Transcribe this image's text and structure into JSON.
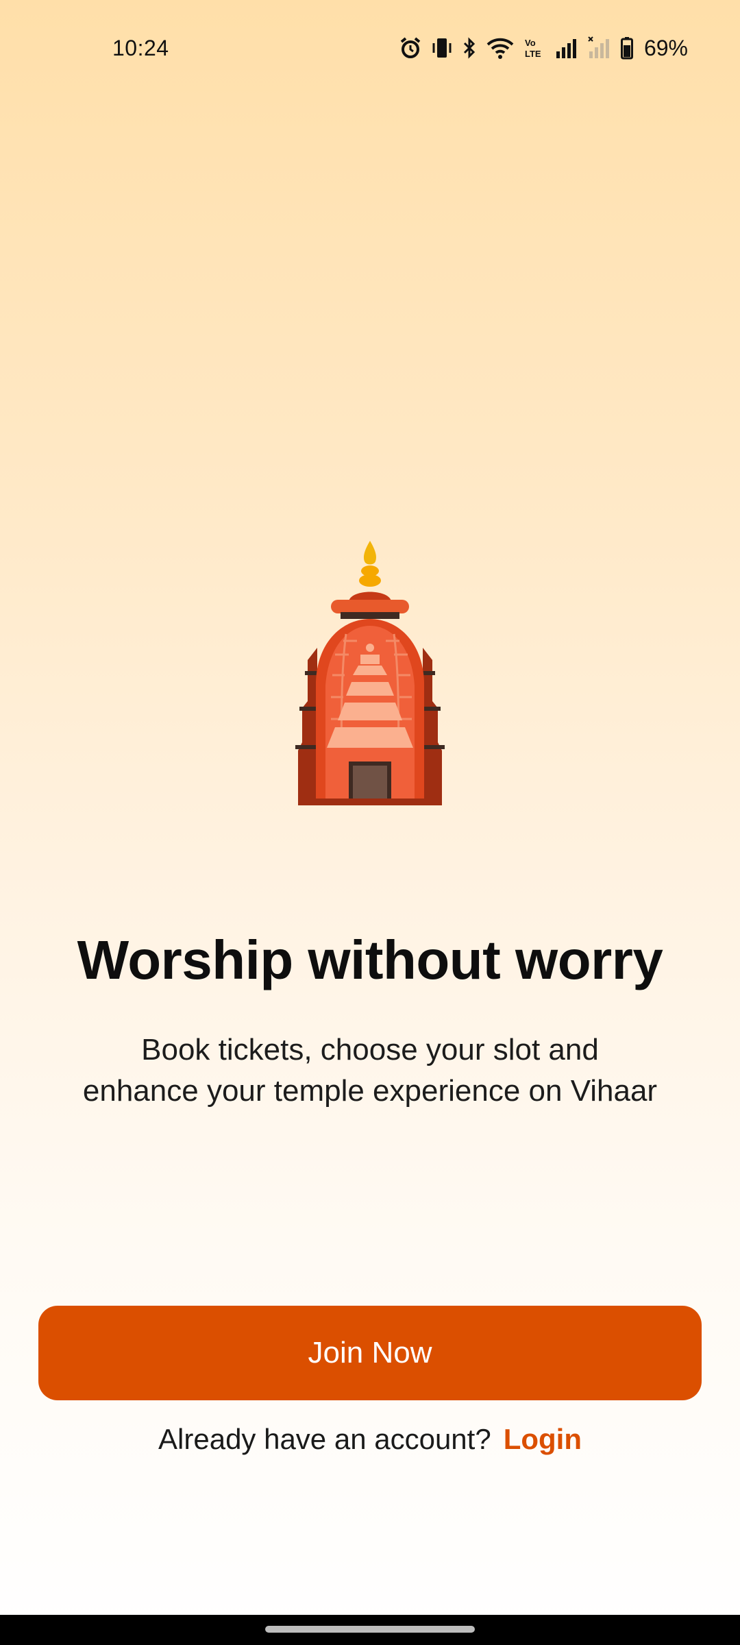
{
  "status_bar": {
    "time": "10:24",
    "icons": [
      "alarm-icon",
      "vibrate-icon",
      "bluetooth-icon",
      "wifi-icon",
      "volte-icon",
      "signal-icon",
      "signal-no-service-icon",
      "battery-icon"
    ],
    "volte_label": "Vo LTE",
    "battery_percent": "69%"
  },
  "hero": {
    "icon": "temple-icon"
  },
  "onboarding": {
    "headline": "Worship without worry",
    "subtitle_line1": "Book tickets, choose your slot and",
    "subtitle_line2": "enhance your temple experience on Vihaar"
  },
  "actions": {
    "join_label": "Join Now",
    "login_prompt": "Already have an account?",
    "login_label": "Login"
  },
  "colors": {
    "accent": "#DB4F00",
    "background_top": "#FFDFA9",
    "background_bottom": "#FFFFFF"
  }
}
